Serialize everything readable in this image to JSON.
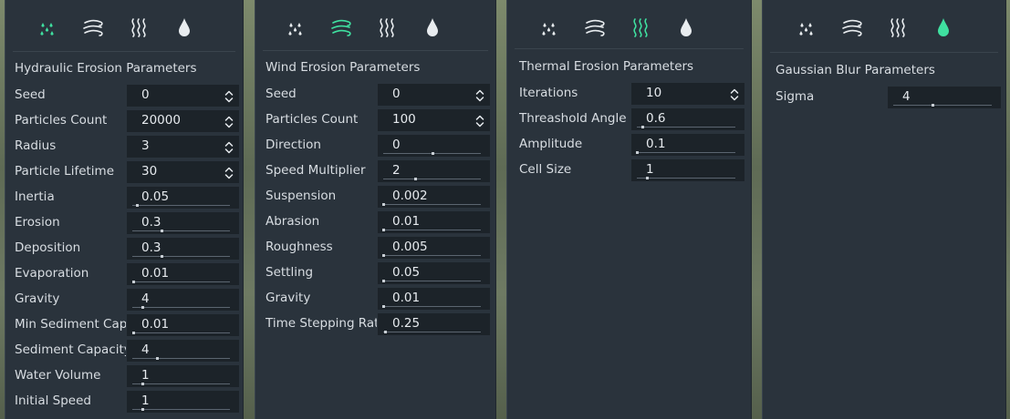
{
  "colors": {
    "accent": "#3fe0a0",
    "icon": "#e8ecef",
    "panel": "#2a333c",
    "field": "#1c2329"
  },
  "tab_icons": [
    "rain-drops-icon",
    "wind-icon",
    "heat-waves-icon",
    "water-drop-icon"
  ],
  "panels": [
    {
      "title": "Hydraulic Erosion Parameters",
      "active_tab": 0,
      "params": [
        {
          "label": "Seed",
          "value": "0",
          "kind": "spin"
        },
        {
          "label": "Particles Count",
          "value": "20000",
          "kind": "spin"
        },
        {
          "label": "Radius",
          "value": "3",
          "kind": "spin"
        },
        {
          "label": "Particle Lifetime",
          "value": "30",
          "kind": "spin"
        },
        {
          "label": "Inertia",
          "value": "0.05",
          "kind": "slider",
          "level": 0.05
        },
        {
          "label": "Erosion",
          "value": "0.3",
          "kind": "slider",
          "level": 0.3
        },
        {
          "label": "Deposition",
          "value": "0.3",
          "kind": "slider",
          "level": 0.3
        },
        {
          "label": "Evaporation",
          "value": "0.01",
          "kind": "slider",
          "level": 0.01
        },
        {
          "label": "Gravity",
          "value": "4",
          "kind": "slider",
          "level": 0.1
        },
        {
          "label": "Min Sediment Capacity",
          "value": "0.01",
          "kind": "slider",
          "level": 0.01
        },
        {
          "label": "Sediment Capacity",
          "value": "4",
          "kind": "slider",
          "level": 0.25
        },
        {
          "label": "Water Volume",
          "value": "1",
          "kind": "slider",
          "level": 0.1
        },
        {
          "label": "Initial Speed",
          "value": "1",
          "kind": "slider",
          "level": 0.1
        }
      ]
    },
    {
      "title": "Wind Erosion Parameters",
      "active_tab": 1,
      "params": [
        {
          "label": "Seed",
          "value": "0",
          "kind": "spin"
        },
        {
          "label": "Particles Count",
          "value": "100",
          "kind": "spin"
        },
        {
          "label": "Direction",
          "value": "0",
          "kind": "slider",
          "level": 0.5
        },
        {
          "label": "Speed Multiplier",
          "value": "2",
          "kind": "slider",
          "level": 0.33
        },
        {
          "label": "Suspension",
          "value": "0.002",
          "kind": "slider",
          "level": 0.0
        },
        {
          "label": "Abrasion",
          "value": "0.01",
          "kind": "slider",
          "level": 0.0
        },
        {
          "label": "Roughness",
          "value": "0.005",
          "kind": "slider",
          "level": 0.0
        },
        {
          "label": "Settling",
          "value": "0.05",
          "kind": "slider",
          "level": 0.0
        },
        {
          "label": "Gravity",
          "value": "0.01",
          "kind": "slider",
          "level": 0.0
        },
        {
          "label": "Time Stepping Rate",
          "value": "0.25",
          "kind": "slider",
          "level": 0.02
        }
      ]
    },
    {
      "title": "Thermal Erosion Parameters",
      "active_tab": 2,
      "params": [
        {
          "label": "Iterations",
          "value": "10",
          "kind": "spin"
        },
        {
          "label": "Threashold Angle",
          "value": "0.6",
          "kind": "slider",
          "level": 0.06
        },
        {
          "label": "Amplitude",
          "value": "0.1",
          "kind": "slider",
          "level": 0.0
        },
        {
          "label": "Cell Size",
          "value": "1",
          "kind": "slider",
          "level": 0.1
        }
      ]
    },
    {
      "title": "Gaussian Blur Parameters",
      "active_tab": 3,
      "params": [
        {
          "label": "Sigma",
          "value": "4",
          "kind": "slider",
          "level": 0.4
        }
      ]
    }
  ]
}
